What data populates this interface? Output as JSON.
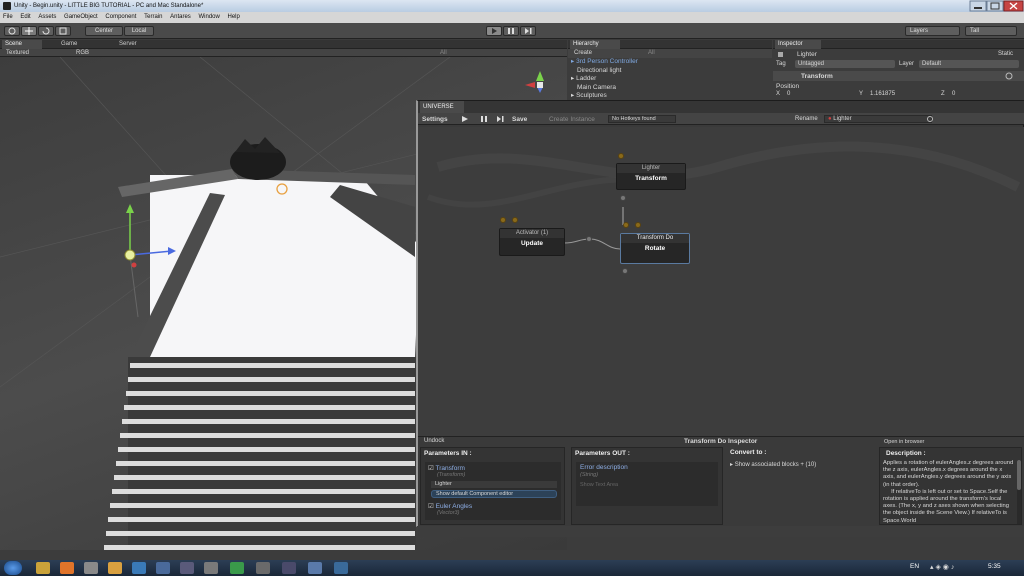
{
  "window": {
    "title": "Unity - Begin.unity - LITTLE BIG TUTORIAL - PC and Mac Standalone*"
  },
  "menu": [
    "File",
    "Edit",
    "Assets",
    "GameObject",
    "Component",
    "Terrain",
    "Antares",
    "Window",
    "Help"
  ],
  "toolbar": {
    "pivot_center": "Center",
    "pivot_local": "Local",
    "layers": "Layers",
    "layout": "Tall"
  },
  "scene": {
    "tabs": [
      "Scene",
      "Game",
      "Server"
    ],
    "render_mode": "Textured",
    "color_mode": "RGB",
    "search_placeholder": "All"
  },
  "hierarchy": {
    "tab": "Hierarchy",
    "create": "Create",
    "search": "All",
    "items": [
      "3rd Person Controller",
      "Directional light",
      "Ladder",
      "Main Camera",
      "Sculptures"
    ]
  },
  "inspector": {
    "tab": "Inspector",
    "object_name": "Lighter",
    "static": "Static",
    "tag_label": "Tag",
    "tag_value": "Untagged",
    "layer_label": "Layer",
    "layer_value": "Default",
    "component": "Transform",
    "position_label": "Position",
    "x_label": "X",
    "x_value": "0",
    "y_label": "Y",
    "y_value": "1.161875",
    "z_label": "Z",
    "z_value": "0"
  },
  "universe": {
    "tab": "UNIVERSE",
    "settings": "Settings",
    "save": "Save",
    "create_instance": "Create Instance",
    "instance_dropdown": "No Hotkeys found",
    "rename": "Rename",
    "lighter_field": "Lighter",
    "nodes": {
      "lighter": {
        "header": "Lighter",
        "body": "Transform"
      },
      "activator": {
        "header": "Activator (1)",
        "body": "Update"
      },
      "transform_do": {
        "header": "Transform Do",
        "body": "Rotate"
      }
    },
    "undock": "Undock",
    "inspector_title": "Transform Do Inspector",
    "open_browser": "Open in browser",
    "params_in": {
      "title": "Parameters IN :",
      "p1_name": "Transform",
      "p1_type": "(Transform)",
      "p1_value": "Lighter",
      "show_default": "Show default Component editor",
      "p2_name": "Euler Angles",
      "p2_type": "(Vector3)"
    },
    "params_out": {
      "title": "Parameters OUT :",
      "err_name": "Error description",
      "err_type": "(String)",
      "show_text_area": "Show Text Area"
    },
    "convert": {
      "title": "Convert to :",
      "item": "Show associated blocks + (10)"
    },
    "description": {
      "title": "Description :",
      "text": "Applies a rotation of eulerAngles.z degrees around the z axis, eulerAngles.x degrees around the x axis, and eulerAngles.y degrees around the y axis (in that order).\n     If relativeTo is left out or set to Space.Self the rotation is applied around the transform's local axes. (The x, y and z axes shown when selecting the object inside the Scene View.) If relativeTo is Space.World"
    }
  },
  "taskbar": {
    "lang": "EN",
    "time": "5:35"
  },
  "colors": {
    "editor_bg": "#3c3c3c",
    "node_bg": "#262626",
    "link_blue": "#7fa8e0",
    "desktop": "#3b5a7a"
  }
}
